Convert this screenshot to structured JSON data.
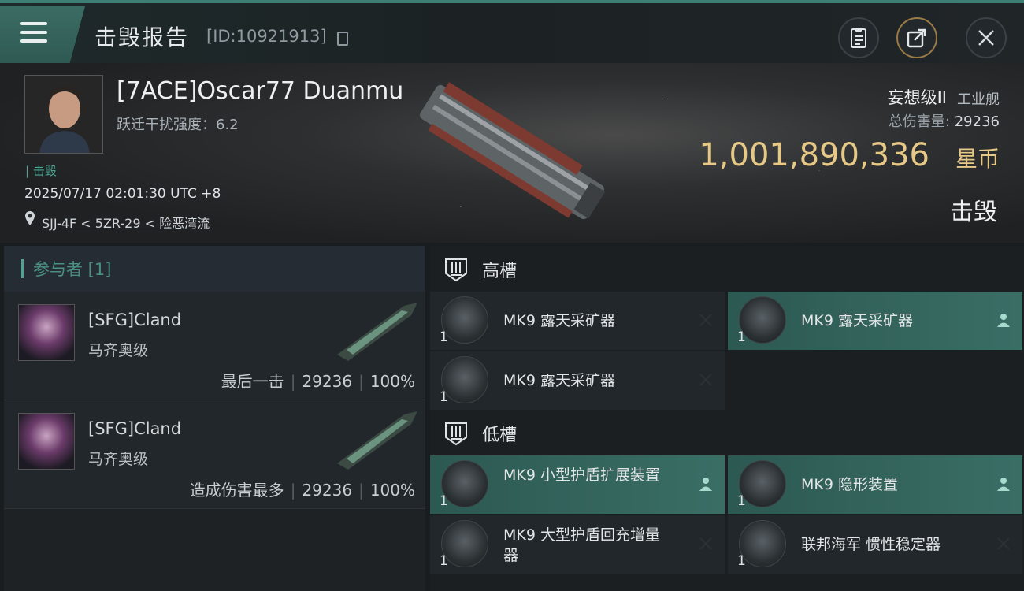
{
  "header": {
    "title": "击毁报告",
    "report_id": "[ID:10921913]"
  },
  "victim": {
    "name": "[7ACE]Oscar77 Duanmu",
    "warp_disruption": "跃迁干扰强度：6.2",
    "tag": "击毁",
    "timestamp": "2025/07/17 02:01:30 UTC +8",
    "location": "SJJ-4F < 5ZR-29 < 险恶湾流",
    "ship_name": "妄想级II",
    "ship_class": "工业舰",
    "total_damage_label": "总伤害量:",
    "total_damage": "29236",
    "isk_value": "1,001,890,336",
    "isk_unit": "星币",
    "status": "击毁"
  },
  "participants": {
    "header": "参与者 [1]",
    "items": [
      {
        "name": "[SFG]Cland",
        "ship": "马齐奥级",
        "role": "最后一击",
        "damage": "29236",
        "percent": "100%"
      },
      {
        "name": "[SFG]Cland",
        "ship": "马齐奥级",
        "role": "造成伤害最多",
        "damage": "29236",
        "percent": "100%"
      }
    ]
  },
  "slots": {
    "high": {
      "label": "高槽",
      "modules": [
        {
          "name": "MK9 露天采矿器",
          "qty": "1",
          "state": "destroyed"
        },
        {
          "name": "MK9 露天采矿器",
          "qty": "1",
          "state": "dropped"
        },
        {
          "name": "MK9 露天采矿器",
          "qty": "1",
          "state": "destroyed"
        }
      ]
    },
    "low": {
      "label": "低槽",
      "modules": [
        {
          "name": "MK9 小型护盾扩展装置",
          "qty": "1",
          "state": "dropped"
        },
        {
          "name": "MK9 隐形装置",
          "qty": "1",
          "state": "dropped"
        },
        {
          "name": "MK9 大型护盾回充增量器",
          "qty": "1",
          "state": "destroyed"
        },
        {
          "name": "联邦海军 惯性稳定器",
          "qty": "1",
          "state": "destroyed"
        }
      ]
    }
  },
  "colors": {
    "accent": "#4fa393",
    "isk": "#e7c987",
    "dropped_bg": "#3a6e65"
  }
}
